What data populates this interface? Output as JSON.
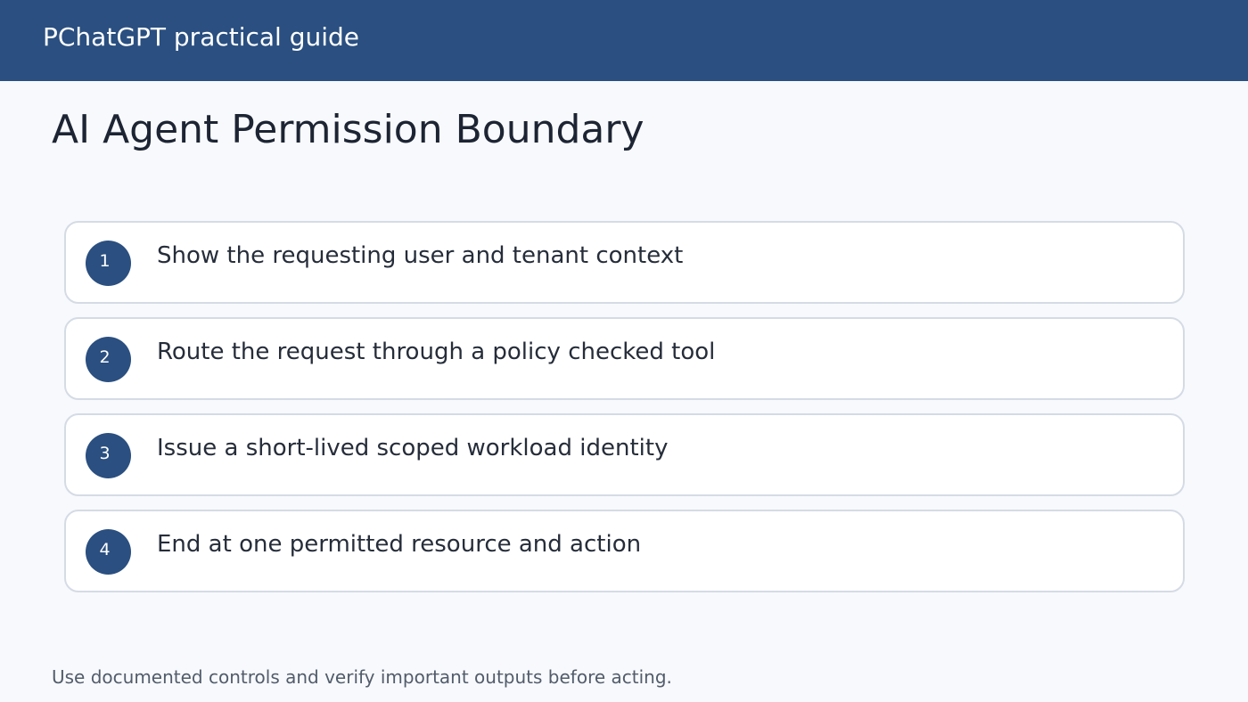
{
  "header": {
    "brand": "PChatGPT practical guide"
  },
  "main": {
    "title": "AI Agent Permission Boundary",
    "steps": [
      {
        "number": "1",
        "text": "Show the requesting user and tenant context"
      },
      {
        "number": "2",
        "text": "Route the request through a policy checked tool"
      },
      {
        "number": "3",
        "text": "Issue a short-lived scoped workload identity"
      },
      {
        "number": "4",
        "text": "End at one permitted resource and action"
      }
    ]
  },
  "footer": {
    "note": "Use documented controls and verify important outputs before acting."
  },
  "colors": {
    "header_bg": "#2a4f80",
    "page_bg": "#f7f9fc",
    "step_badge": "#2a4f80",
    "card_border": "#d5dbe5"
  }
}
